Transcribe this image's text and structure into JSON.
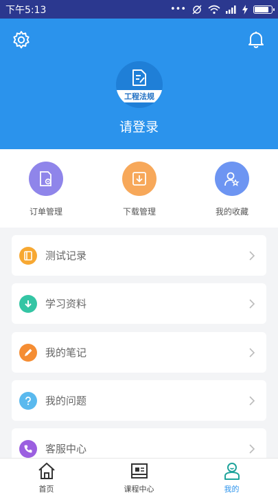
{
  "status_bar": {
    "time": "下午5:13",
    "dots": "•••"
  },
  "header": {
    "login_text": "请登录",
    "avatar_caption": "工程法规"
  },
  "quick_actions": [
    {
      "label": "订单管理",
      "icon": "order-doc-gear-icon",
      "color": "#8f85ea"
    },
    {
      "label": "下载管理",
      "icon": "download-icon",
      "color": "#f7a85a"
    },
    {
      "label": "我的收藏",
      "icon": "user-star-icon",
      "color": "#6d95f2"
    }
  ],
  "menu": [
    {
      "label": "测试记录",
      "icon": "notebook-icon",
      "color": "#f7a832"
    },
    {
      "label": "学习资料",
      "icon": "download-arrow-icon",
      "color": "#34c5a4"
    },
    {
      "label": "我的笔记",
      "icon": "pencil-icon",
      "color": "#f58d33"
    },
    {
      "label": "我的问题",
      "icon": "question-icon",
      "color": "#5ab9ee"
    },
    {
      "label": "客服中心",
      "icon": "phone-icon",
      "color": "#9b5fe0"
    }
  ],
  "tabs": [
    {
      "label": "首页",
      "icon": "home-icon",
      "active": false
    },
    {
      "label": "课程中心",
      "icon": "course-icon",
      "active": false
    },
    {
      "label": "我的",
      "icon": "profile-icon",
      "active": true
    }
  ],
  "battery_level": 0.9
}
